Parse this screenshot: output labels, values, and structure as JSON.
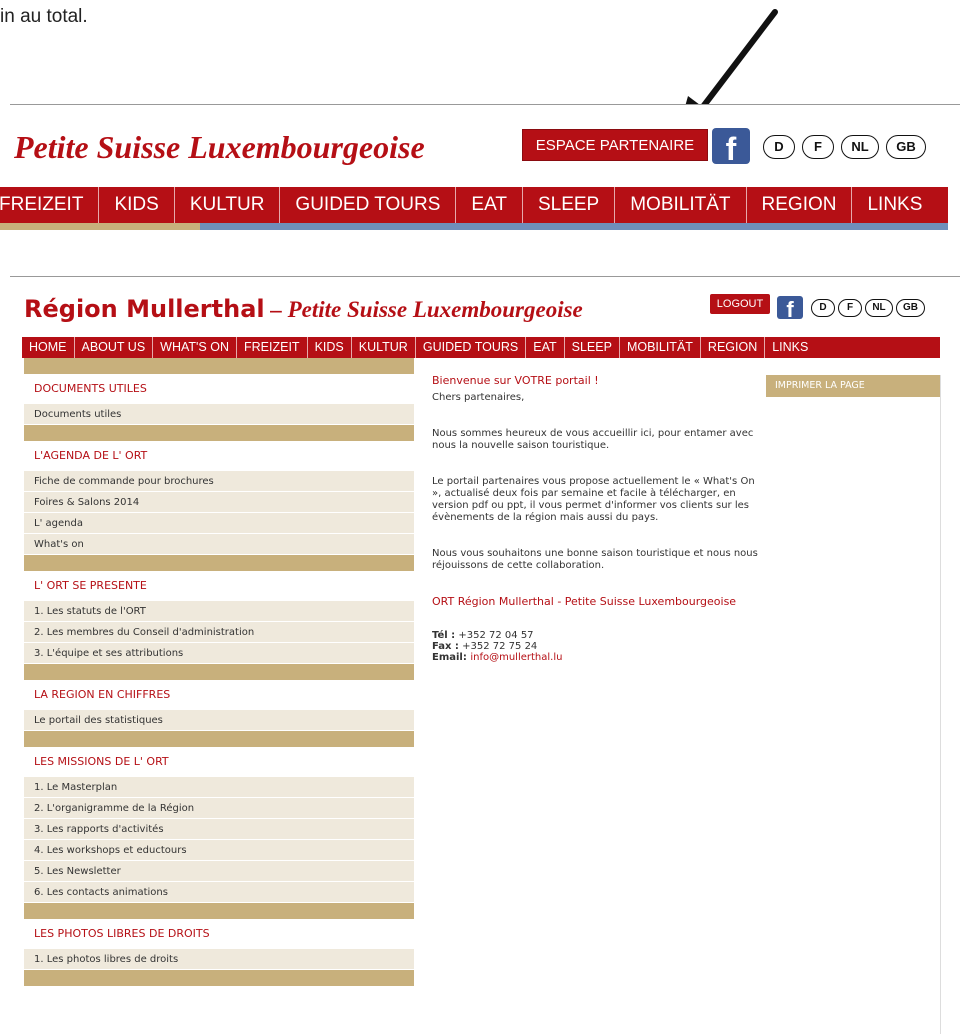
{
  "doc_text": "in au total.",
  "header_top": {
    "title": "Petite Suisse Luxembourgeoise",
    "partner_button": "ESPACE PARTENAIRE",
    "facebook": "f",
    "languages": [
      "D",
      "F",
      "NL",
      "GB"
    ],
    "nav": [
      "FREIZEIT",
      "KIDS",
      "KULTUR",
      "GUIDED TOURS",
      "EAT",
      "SLEEP",
      "MOBILITÄT",
      "REGION",
      "LINKS"
    ]
  },
  "site": {
    "logo_main": "Région Mullerthal",
    "logo_sub": " – Petite Suisse Luxembourgeoise",
    "logout": "LOGOUT",
    "facebook": "f",
    "languages": [
      "D",
      "F",
      "NL",
      "GB"
    ],
    "nav": [
      "HOME",
      "ABOUT US",
      "WHAT'S ON",
      "FREIZEIT",
      "KIDS",
      "KULTUR",
      "GUIDED TOURS",
      "EAT",
      "SLEEP",
      "MOBILITÄT",
      "REGION",
      "LINKS"
    ],
    "sidebar": [
      {
        "title": "DOCUMENTS UTILES",
        "items": [
          "Documents utiles"
        ]
      },
      {
        "title": "L'AGENDA DE L' ORT",
        "items": [
          "Fiche de commande pour brochures",
          "Foires & Salons 2014",
          "L' agenda",
          "What's on"
        ]
      },
      {
        "title": "L' ORT SE PRESENTE",
        "items": [
          "1. Les statuts de l'ORT",
          "2. Les membres du Conseil d'administration",
          "3. L'équipe et ses attributions"
        ]
      },
      {
        "title": "LA REGION EN CHIFFRES",
        "items": [
          "Le portail des statistiques"
        ]
      },
      {
        "title": "LES MISSIONS DE L' ORT",
        "items": [
          "1. Le Masterplan",
          "2. L'organigramme de la Région",
          "3. Les rapports d'activités",
          "4. Les workshops et eductours",
          "5. Les Newsletter",
          "6. Les contacts animations"
        ]
      },
      {
        "title": "LES PHOTOS LIBRES DE DROITS",
        "items": [
          "1. Les photos libres de droits"
        ]
      }
    ],
    "content": {
      "welcome": "Bienvenue sur VOTRE portail !",
      "greeting": "Chers partenaires,",
      "p1": "Nous sommes heureux de vous accueillir ici, pour entamer avec nous la nouvelle saison touristique.",
      "p2": "Le portail partenaires vous propose actuellement le « What's On », actualisé deux fois par semaine et facile à télécharger, en version pdf ou ppt, il vous permet d'informer vos clients sur les évènements de la région mais aussi du pays.",
      "p3": "Nous vous souhaitons une bonne saison touristique et nous nous réjouissons de cette collaboration.",
      "org_name": "ORT Région Mullerthal - Petite Suisse Luxembourgeoise",
      "tel_label": "Tél :",
      "tel": " +352 72 04 57",
      "fax_label": "Fax :",
      "fax": " +352 72 75 24",
      "email_label": "Email",
      "email": "info@mullerthal.lu"
    },
    "print_button": "IMPRIMER LA PAGE"
  },
  "colors": {
    "brand_red": "#b50f15",
    "band_tan": "#c8b07c",
    "item_bg": "#efe9dc",
    "facebook_blue": "#3b5998"
  }
}
